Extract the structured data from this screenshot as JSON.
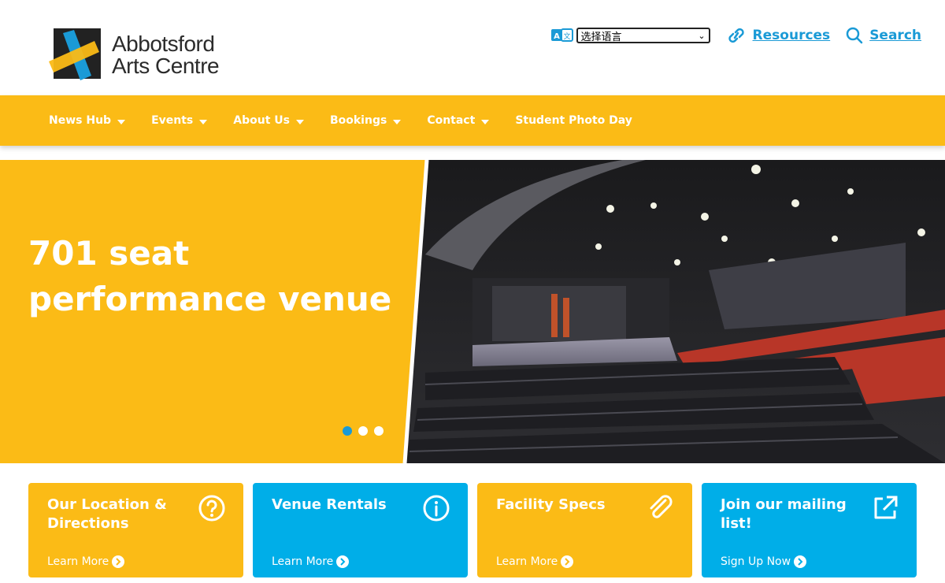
{
  "header": {
    "logo": {
      "line1": "Abbotsford",
      "line2": "Arts Centre"
    },
    "language_select": {
      "value": "选择语言"
    },
    "links": {
      "resources": "Resources",
      "search": "Search"
    }
  },
  "nav": {
    "items": [
      {
        "label": "News Hub",
        "has_dropdown": true
      },
      {
        "label": "Events",
        "has_dropdown": true
      },
      {
        "label": "About Us",
        "has_dropdown": true
      },
      {
        "label": "Bookings",
        "has_dropdown": true
      },
      {
        "label": "Contact",
        "has_dropdown": true
      },
      {
        "label": "Student Photo Day",
        "has_dropdown": false
      }
    ]
  },
  "hero": {
    "title_line1": "701 seat",
    "title_line2": "performance venue",
    "slides_total": 3,
    "active_slide": 1
  },
  "cards": [
    {
      "title": "Our Location & Directions",
      "link": "Learn More",
      "icon": "question-icon",
      "color": "#fbbb16"
    },
    {
      "title": "Venue Rentals",
      "link": "Learn More",
      "icon": "info-icon",
      "color": "#00aee8"
    },
    {
      "title": "Facility Specs",
      "link": "Learn More",
      "icon": "paperclip-icon",
      "color": "#fbbb16"
    },
    {
      "title": "Join our mailing list!",
      "link": "Sign Up Now",
      "icon": "external-link-icon",
      "color": "#00aee8"
    }
  ],
  "colors": {
    "brand_yellow": "#fbbb16",
    "brand_blue": "#00aee8",
    "link_blue": "#1a9ad6"
  }
}
